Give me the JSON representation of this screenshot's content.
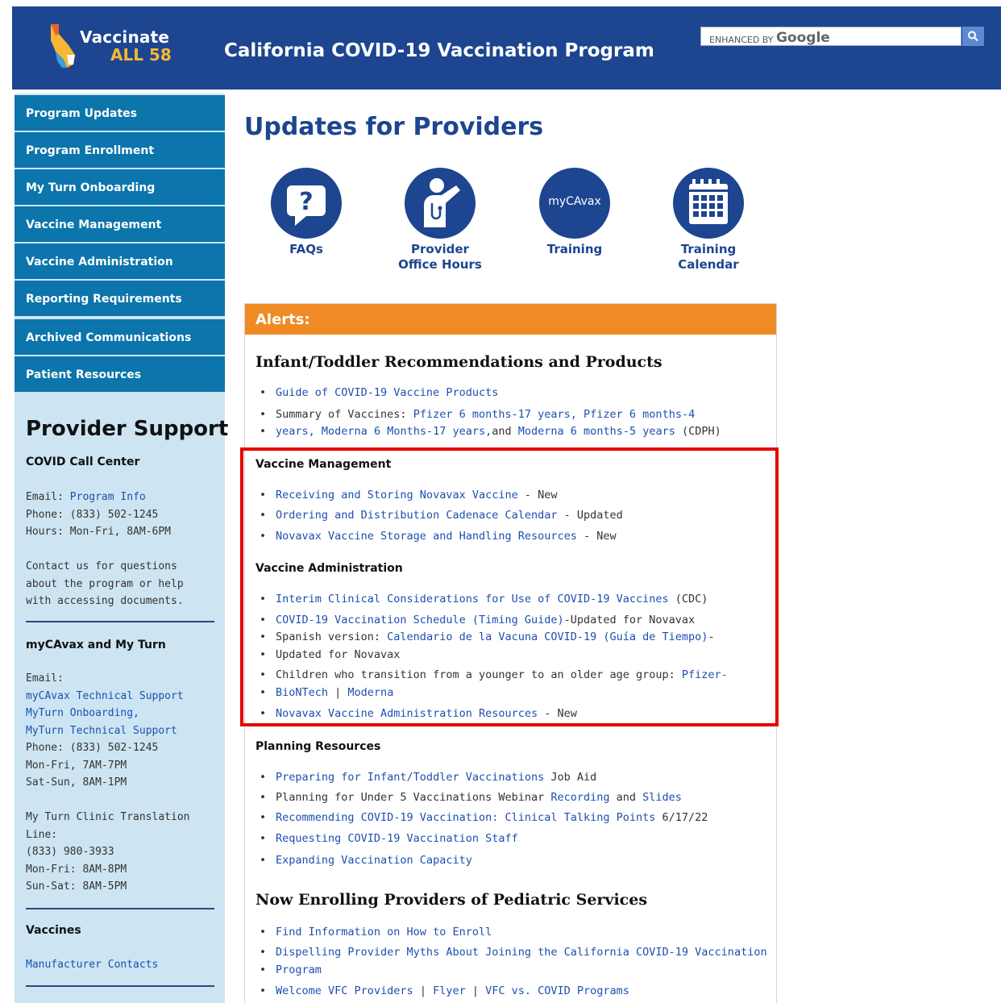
{
  "header": {
    "logo_line1": "Vaccinate",
    "logo_line2": "ALL 58",
    "title": "California COVID-19 Vaccination Program",
    "search_brand_small": "ENHANCED BY",
    "search_brand_big": "Google",
    "search_icon": "search-icon"
  },
  "nav": {
    "items": [
      {
        "label": "Program Updates"
      },
      {
        "label": "Program Enrollment"
      },
      {
        "label": "My Turn Onboarding"
      },
      {
        "label": "Vaccine Management"
      },
      {
        "label": "Vaccine Administration"
      },
      {
        "label": "Reporting Requirements"
      },
      {
        "label": "Archived Communications"
      },
      {
        "label": "Patient Resources"
      }
    ]
  },
  "support": {
    "title": "Provider Support",
    "call_center": {
      "heading": "COVID Call Center",
      "email_label": "Email:",
      "email_link": "Program Info",
      "phone": "Phone: (833) 502-1245",
      "hours": "Hours: Mon-Fri, 8AM-6PM",
      "contact_1": "Contact us for questions",
      "contact_2": "about the program or help",
      "contact_3": "with accessing documents."
    },
    "mycavax": {
      "heading": "myCAvax and My Turn",
      "email_label": "Email:",
      "link_1": "myCAvax Technical Support",
      "link_2": "MyTurn Onboarding,",
      "link_3": "MyTurn Technical Support",
      "phone": "Phone: (833) 502-1245",
      "hours_1": "Mon-Fri, 7AM-7PM",
      "hours_2": "Sat-Sun, 8AM-1PM",
      "translation_1": "My Turn Clinic Translation",
      "translation_2": "Line:",
      "translation_phone": "(833) 980-3933",
      "translation_hours_1": "Mon-Fri: 8AM-8PM",
      "translation_hours_2": "Sun-Sat: 8AM-5PM"
    },
    "vaccines": {
      "heading": "Vaccines",
      "link": "Manufacturer Contacts"
    }
  },
  "main": {
    "title": "Updates for Providers",
    "icons": [
      {
        "label_1": "FAQs",
        "label_2": "",
        "icon": "question-icon"
      },
      {
        "label_1": "Provider",
        "label_2": "Office Hours",
        "icon": "doctor-icon"
      },
      {
        "label_1": "Training",
        "label_2": "",
        "icon": "mycavax-icon",
        "badge": "myCAvax"
      },
      {
        "label_1": "Training",
        "label_2": "Calendar",
        "icon": "calendar-icon"
      }
    ],
    "alerts_label": "Alerts:",
    "infant": {
      "heading": "Infant/Toddler Recommendations and Products",
      "item1_link": "Guide of COVID-19 Vaccine Products",
      "item2_prefix": "Summary of Vaccines: ",
      "item2_link1": "Pfizer 6 months-17 years,",
      "item2_link2": "Pfizer 6 months-4",
      "item2_link2b": "years,",
      "item2_link3": "Moderna 6 Months-17 years,",
      "item2_and": "and",
      "item2_link4": "Moderna 6 months-5 years",
      "item2_suffix": " (CDPH)"
    },
    "vaccine_management": {
      "heading": "Vaccine Management",
      "items": [
        {
          "link": "Receiving and Storing Novavax Vaccine",
          "note": " - New"
        },
        {
          "link": "Ordering and Distribution Cadenace Calendar",
          "note": " - Updated"
        },
        {
          "link": "Novavax Vaccine Storage and Handling Resources",
          "note": " - New"
        }
      ]
    },
    "vaccine_administration": {
      "heading": "Vaccine Administration",
      "item1_link": "Interim Clinical Considerations for Use of COVID-19 Vaccines",
      "item1_note": " (CDC)",
      "item2_link": "COVID-19 Vaccination Schedule (Timing Guide)",
      "item2_note": "-Updated for Novavax",
      "item2_sp_prefix": "Spanish version: ",
      "item2_sp_link": "Calendario de la Vacuna COVID-19 (Guía de Tiempo)",
      "item2_sp_note": "-",
      "item2_sp_note2": "Updated for Novavax",
      "item3_prefix": "Children who transition from a younger to an older age group: ",
      "item3_link1": "Pfizer-",
      "item3_link1b": "BioNTech",
      "item3_sep": " | ",
      "item3_link2": "Moderna",
      "item4_link": "Novavax Vaccine Administration Resources",
      "item4_note": " - New"
    },
    "planning": {
      "heading": "Planning Resources",
      "item1_link": "Preparing for Infant/Toddler Vaccinations",
      "item1_note": " Job Aid",
      "item2_prefix": "Planning for Under 5 Vaccinations Webinar ",
      "item2_link1": "Recording",
      "item2_and": " and ",
      "item2_link2": "Slides",
      "item3_link": "Recommending COVID-19 Vaccination: Clinical Talking Points",
      "item3_note": " 6/17/22",
      "item4_link": "Requesting COVID-19 Vaccination Staff",
      "item5_link": "Expanding Vaccination Capacity"
    },
    "enrolling": {
      "heading": "Now Enrolling Providers of Pediatric Services",
      "item1_link": "Find Information on How to Enroll",
      "item2_link_a": "Dispelling Provider Myths About Joining the California COVID-19 Vaccination",
      "item2_link_b": "Program",
      "item3_link1": "Welcome VFC Providers",
      "item3_sep": " | ",
      "item3_link2": "Flyer",
      "item3_link3": "VFC vs. COVID Programs"
    }
  }
}
